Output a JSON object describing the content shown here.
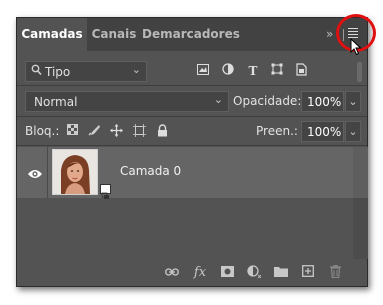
{
  "tabs": [
    {
      "label": "Camadas",
      "active": true
    },
    {
      "label": "Canais",
      "active": false
    },
    {
      "label": "Demarcadores",
      "active": false
    }
  ],
  "overflow_glyph": "»",
  "filter": {
    "label": "Tipo",
    "icon": "search-icon"
  },
  "filter_icons": [
    "pixel-layer-filter-icon",
    "adjustment-layer-filter-icon",
    "type-layer-filter-icon",
    "shape-layer-filter-icon",
    "smart-object-filter-icon"
  ],
  "blend_mode": "Normal",
  "opacity": {
    "label": "Opacidade:",
    "value": "100%"
  },
  "lock": {
    "label": "Bloq.:",
    "icons": [
      "lock-transparency-icon",
      "lock-pixels-icon",
      "lock-position-icon",
      "prevent-auto-nesting-icon",
      "lock-all-icon"
    ]
  },
  "fill": {
    "label": "Preen.:",
    "value": "100%"
  },
  "layers": [
    {
      "name": "Camada 0",
      "visible": true,
      "smart_object": true
    }
  ],
  "bottom_icons": [
    "link-layers-icon",
    "fx-icon",
    "add-mask-icon",
    "adjustment-layer-icon",
    "new-group-icon",
    "new-layer-icon",
    "delete-icon"
  ],
  "colors": {
    "panel": "#535353",
    "tabbar": "#424242",
    "selected_layer": "#656565",
    "highlight": "#e01010"
  }
}
